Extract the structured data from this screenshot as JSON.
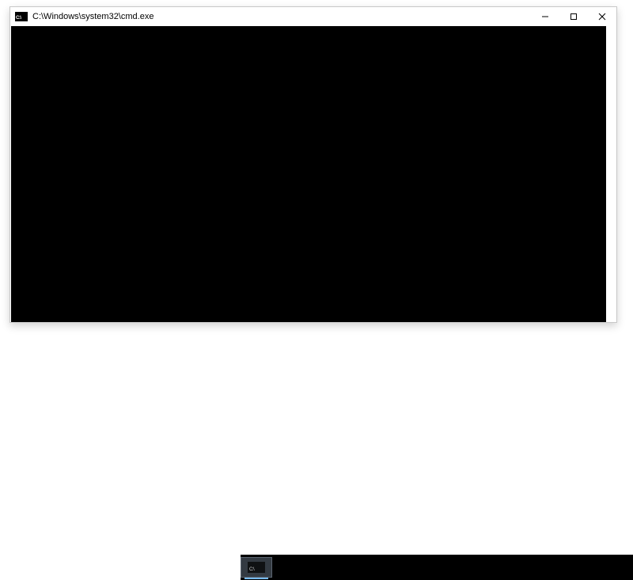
{
  "window": {
    "title": "C:\\Windows\\system32\\cmd.exe",
    "icon_label": "C:\\"
  },
  "taskbar": {
    "item_icon_label": "C:\\"
  }
}
